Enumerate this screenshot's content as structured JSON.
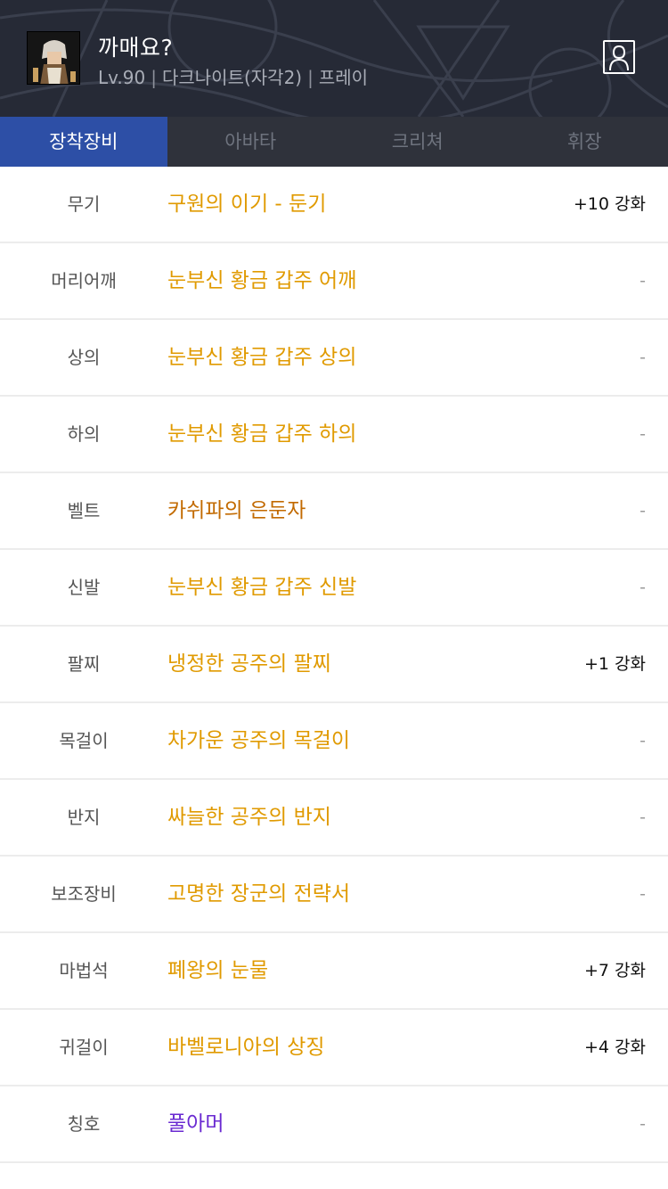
{
  "header": {
    "character_name": "까매요?",
    "level": "Lv.90",
    "job": "다크나이트(자각2)",
    "server": "프레이",
    "separator": "|",
    "avatar_icon": "character-portrait-icon",
    "profile_icon": "user-profile-icon"
  },
  "tabs": [
    {
      "label": "장착장비",
      "active": true
    },
    {
      "label": "아바타",
      "active": false
    },
    {
      "label": "크리쳐",
      "active": false
    },
    {
      "label": "휘장",
      "active": false
    }
  ],
  "colors": {
    "epic": "#e09a00",
    "legendary": "#c26a00",
    "unique": "#6a2ad1",
    "tab_active": "#2d4fa6",
    "header_bg": "#262a36"
  },
  "equipment": [
    {
      "slot": "무기",
      "name": "구원의 이기 - 둔기",
      "rarity": "epic",
      "enhance": "+10 강화"
    },
    {
      "slot": "머리어깨",
      "name": "눈부신 황금 갑주 어깨",
      "rarity": "epic",
      "enhance": "-"
    },
    {
      "slot": "상의",
      "name": "눈부신 황금 갑주 상의",
      "rarity": "epic",
      "enhance": "-"
    },
    {
      "slot": "하의",
      "name": "눈부신 황금 갑주 하의",
      "rarity": "epic",
      "enhance": "-"
    },
    {
      "slot": "벨트",
      "name": "카쉬파의 은둔자",
      "rarity": "legendary",
      "enhance": "-"
    },
    {
      "slot": "신발",
      "name": "눈부신 황금 갑주 신발",
      "rarity": "epic",
      "enhance": "-"
    },
    {
      "slot": "팔찌",
      "name": "냉정한 공주의 팔찌",
      "rarity": "epic",
      "enhance": "+1 강화"
    },
    {
      "slot": "목걸이",
      "name": "차가운 공주의 목걸이",
      "rarity": "epic",
      "enhance": "-"
    },
    {
      "slot": "반지",
      "name": "싸늘한 공주의 반지",
      "rarity": "epic",
      "enhance": "-"
    },
    {
      "slot": "보조장비",
      "name": "고명한 장군의 전략서",
      "rarity": "epic",
      "enhance": "-"
    },
    {
      "slot": "마법석",
      "name": "폐왕의 눈물",
      "rarity": "epic",
      "enhance": "+7 강화"
    },
    {
      "slot": "귀걸이",
      "name": "바벨로니아의 상징",
      "rarity": "epic",
      "enhance": "+4 강화"
    },
    {
      "slot": "칭호",
      "name": "풀아머",
      "rarity": "unique",
      "enhance": "-"
    }
  ]
}
